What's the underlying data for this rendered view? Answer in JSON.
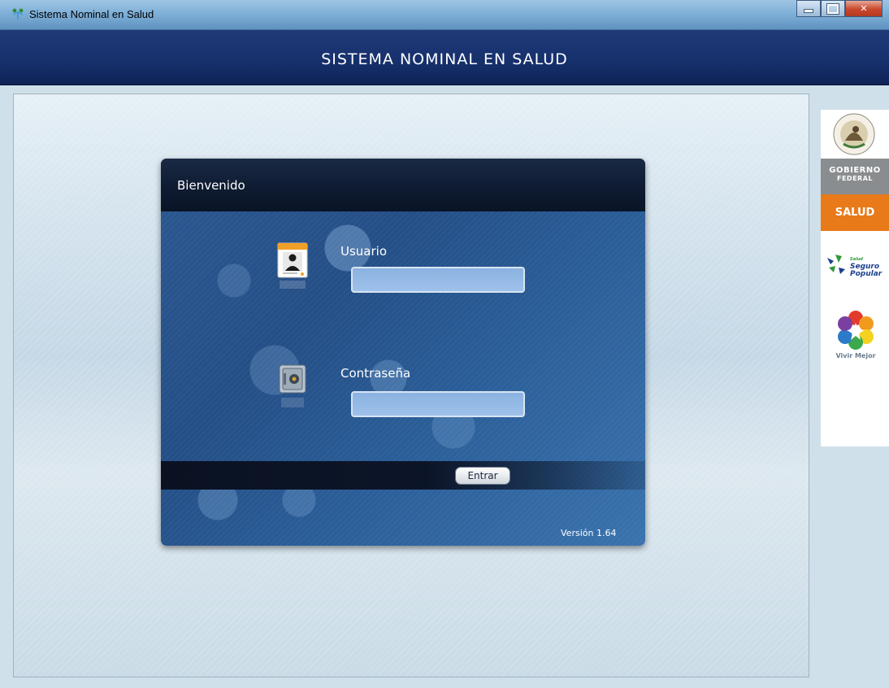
{
  "window": {
    "title": "Sistema Nominal en Salud"
  },
  "banner": {
    "title": "SISTEMA NOMINAL EN SALUD"
  },
  "login": {
    "header": "Bienvenido",
    "user_label": "Usuario",
    "user_value": "",
    "password_label": "Contraseña",
    "password_value": "",
    "enter_label": "Entrar",
    "version": "Versión 1.64"
  },
  "sidebar": {
    "gobierno_line1": "GOBIERNO",
    "gobierno_line2": "FEDERAL",
    "salud": "SALUD",
    "seguro_popular_small": "Salud",
    "seguro_popular_line1": "Seguro",
    "seguro_popular_line2": "Popular",
    "vivir_mejor": "Vivir Mejor",
    "seal_text": "ESTADOS UNIDOS MEXICANOS"
  },
  "colors": {
    "banner": "#16306c",
    "dialog": "#2c5891",
    "salud_orange": "#e87a19",
    "gobierno_gray": "#8a8d8f"
  }
}
